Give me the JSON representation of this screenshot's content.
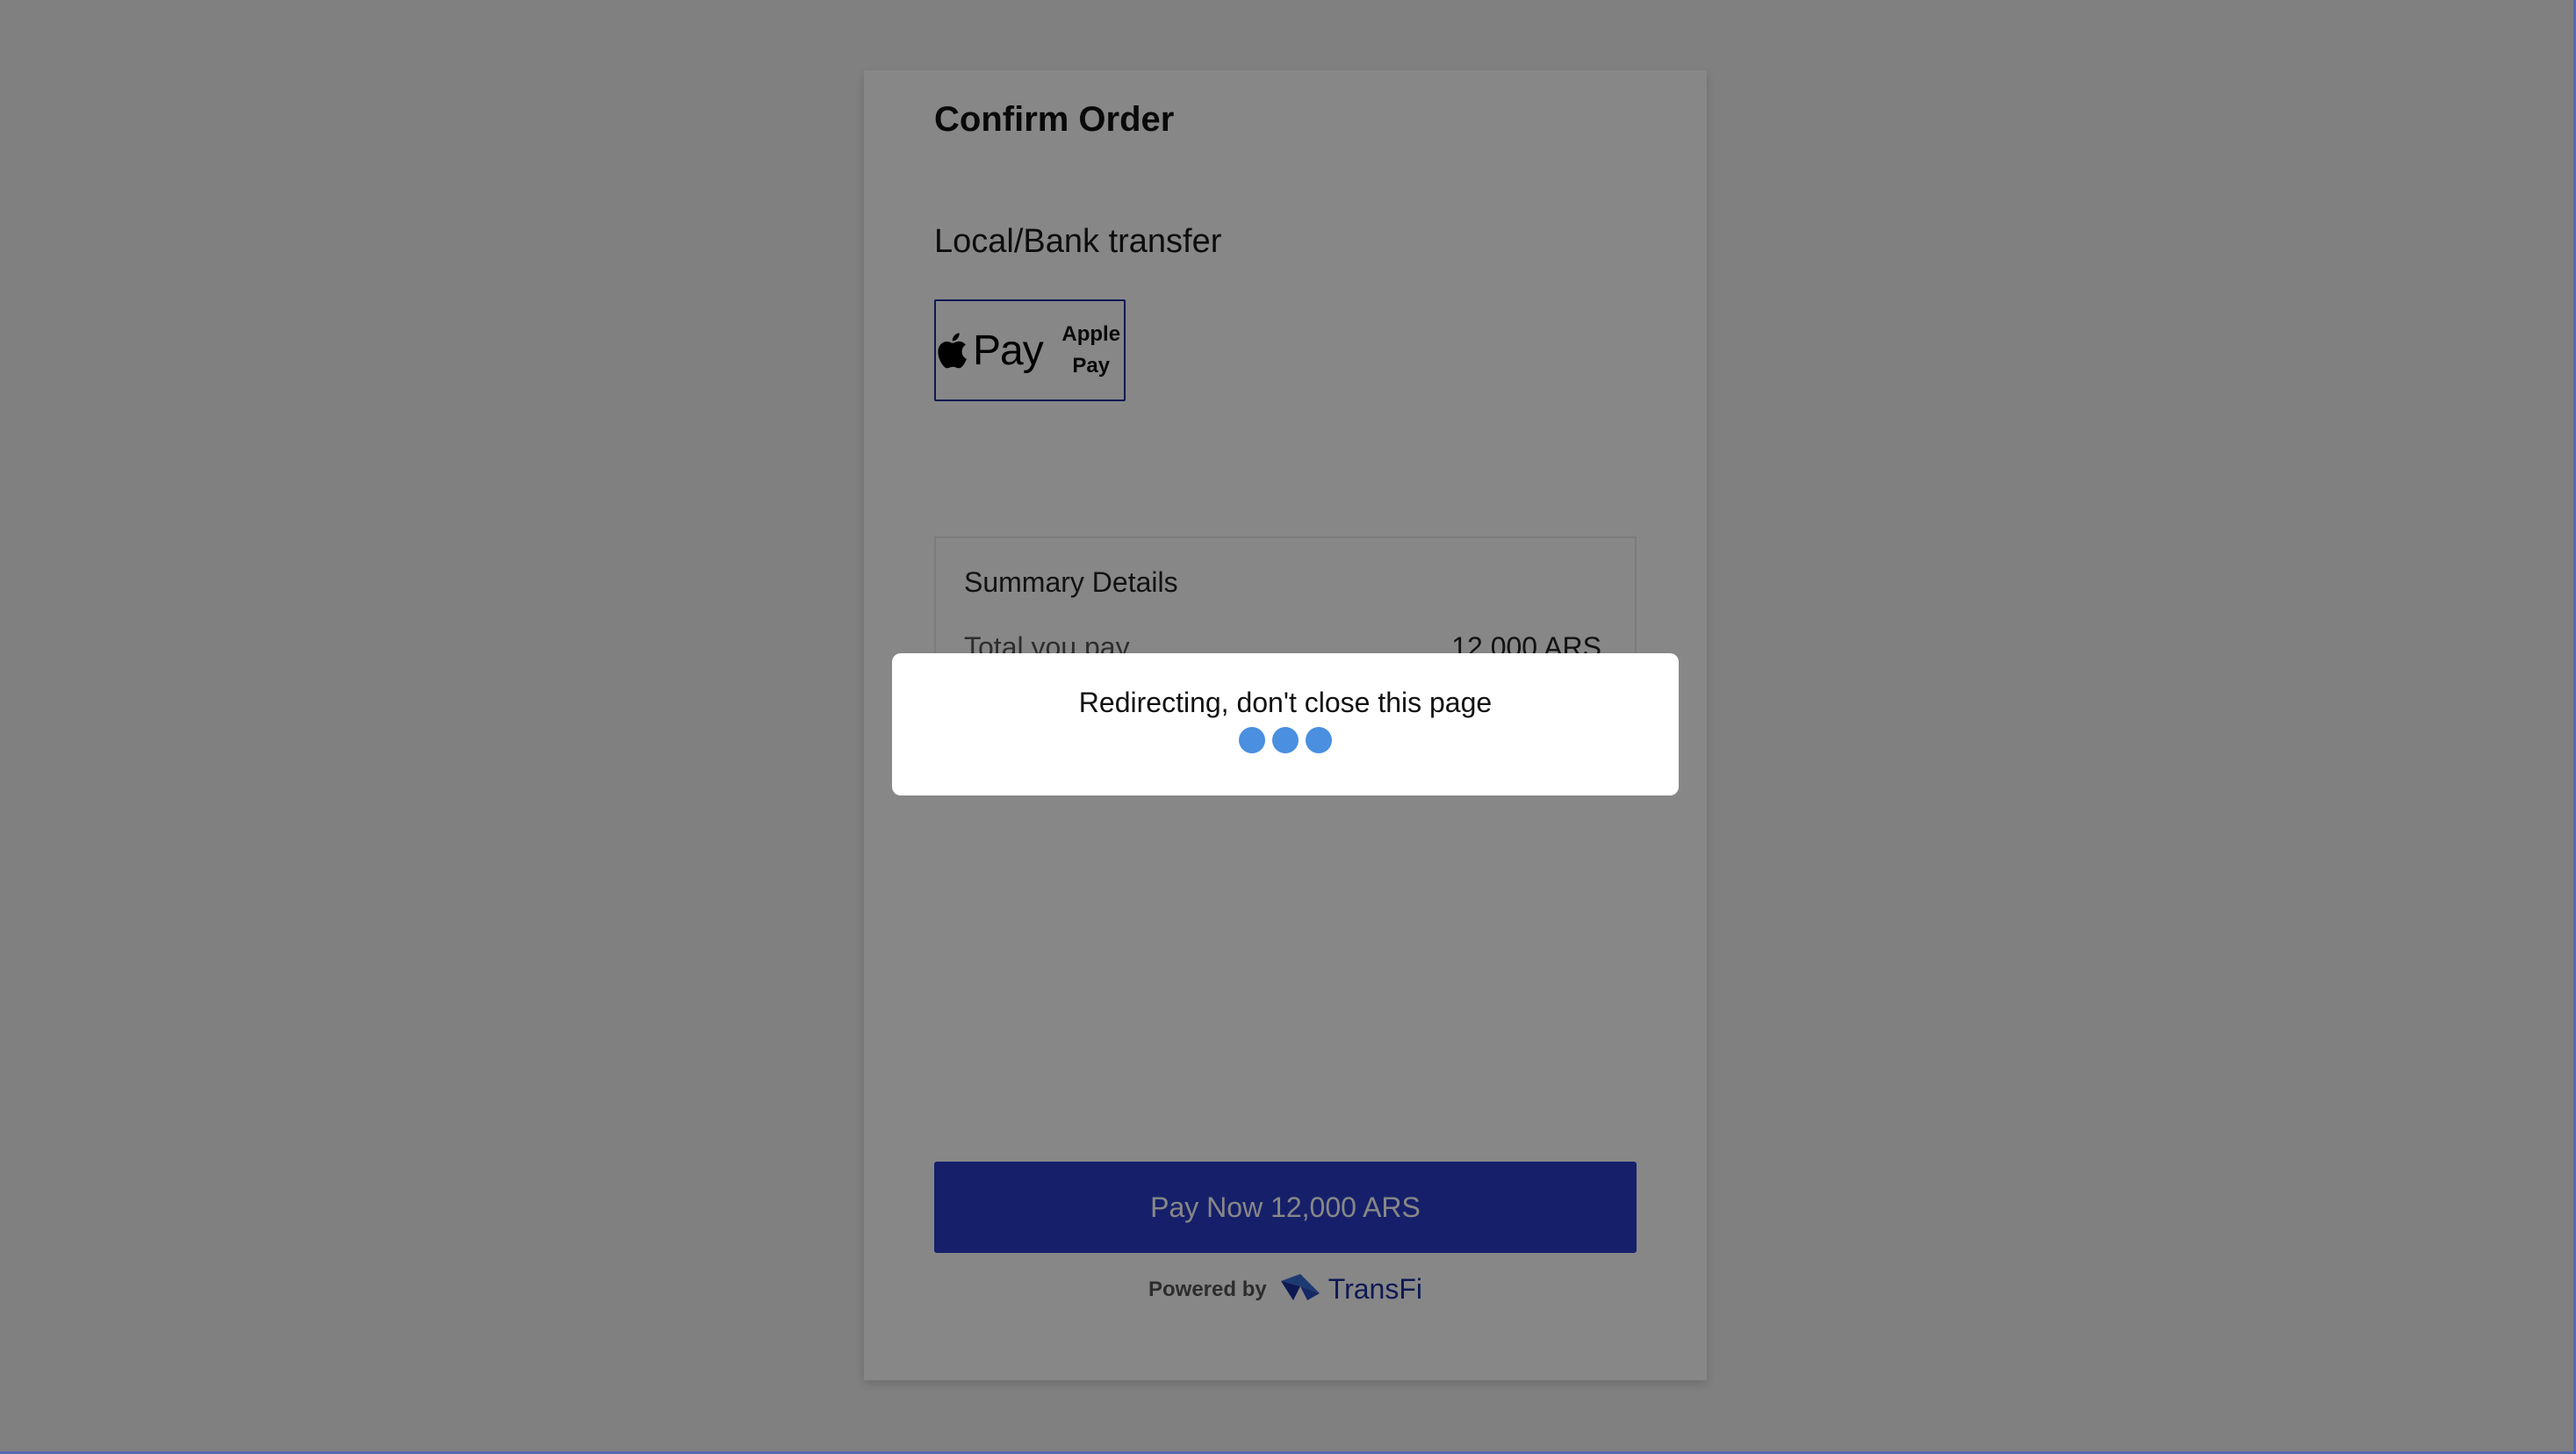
{
  "order": {
    "title": "Confirm Order",
    "payment_section": "Local/Bank transfer",
    "method": {
      "brand_mark": "Pay",
      "label": "Apple Pay",
      "icon": "apple-icon"
    }
  },
  "summary": {
    "title": "Summary Details",
    "total_label": "Total you pay",
    "total_value": "12,000 ARS"
  },
  "pay_button": {
    "label": "Pay Now 12,000 ARS"
  },
  "footer": {
    "powered_by": "Powered by",
    "brand": "TransFi"
  },
  "modal": {
    "message": "Redirecting, don't close this page",
    "loader_dot_count": 3
  },
  "colors": {
    "accent": "#2a3ec9",
    "loader": "#4a8fe0",
    "overlay": "rgba(0,0,0,0.47)"
  }
}
